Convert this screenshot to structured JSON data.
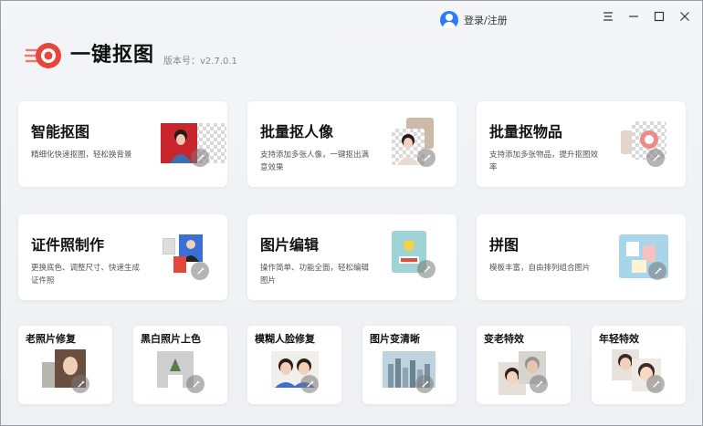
{
  "header": {
    "login_text": "登录/注册",
    "window_controls": [
      "menu-icon",
      "minimize-icon",
      "maximize-icon",
      "close-icon"
    ]
  },
  "logo": {
    "name": "一键抠图",
    "version": "版本号：v2.7.0.1",
    "brand_color": "#e8453c"
  },
  "feature_cards": [
    {
      "title": "智能抠图",
      "desc": "精细化快速抠图，轻松换背景"
    },
    {
      "title": "批量抠人像",
      "desc": "支持添加多张人像，一键抠出满意效果"
    },
    {
      "title": "批量抠物品",
      "desc": "支持添加多张物品，提升抠图效率"
    },
    {
      "title": "证件照制作",
      "desc": "更换底色、调整尺寸、快速生成证件照"
    },
    {
      "title": "图片编辑",
      "desc": "操作简单、功能全面，轻松编辑图片"
    },
    {
      "title": "拼图",
      "desc": "模板丰富，自由排列组合图片"
    }
  ],
  "tool_cards": [
    {
      "title": "老照片修复"
    },
    {
      "title": "黑白照片上色"
    },
    {
      "title": "模糊人脸修复"
    },
    {
      "title": "图片变清晰"
    },
    {
      "title": "变老特效"
    },
    {
      "title": "年轻特效"
    }
  ]
}
